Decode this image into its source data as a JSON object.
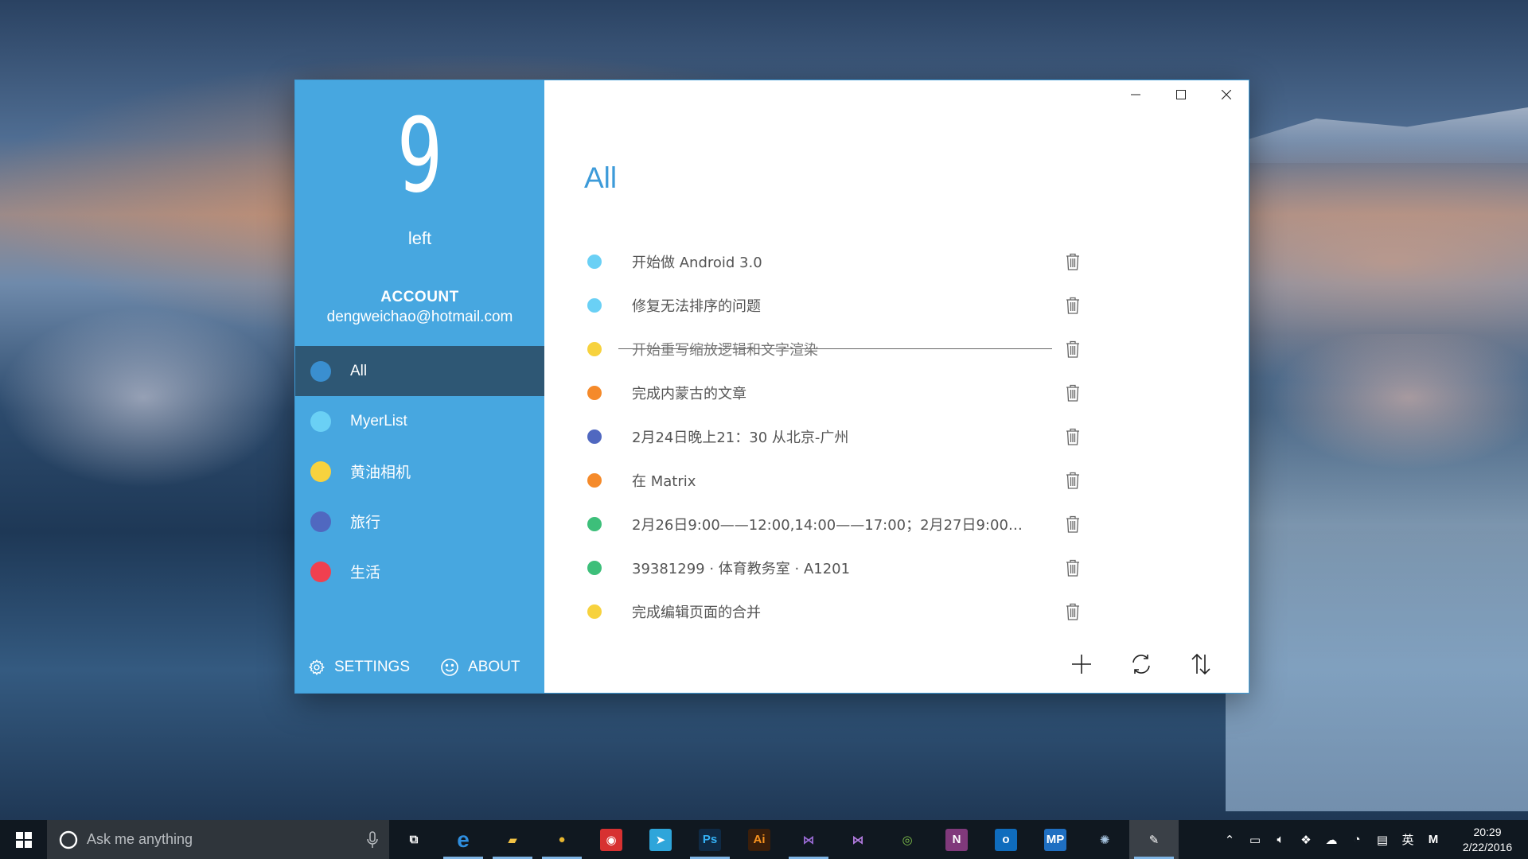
{
  "sidebar": {
    "count": "9",
    "count_caption": "left",
    "account_title": "ACCOUNT",
    "account_email": "dengweichao@hotmail.com",
    "categories": [
      {
        "label": "All",
        "color": "#3a8fd0",
        "active": true
      },
      {
        "label": "MyerList",
        "color": "#6ad0f5",
        "active": false
      },
      {
        "label": "黄油相机",
        "color": "#f7d23e",
        "active": false
      },
      {
        "label": "旅行",
        "color": "#5068c0",
        "active": false
      },
      {
        "label": "生活",
        "color": "#f0404f",
        "active": false
      }
    ],
    "settings_label": "SETTINGS",
    "about_label": "ABOUT"
  },
  "main": {
    "title": "All",
    "tasks": [
      {
        "text": "开始做 Android 3.0",
        "color": "#6ad0f5",
        "done": false
      },
      {
        "text": "修复无法排序的问题",
        "color": "#6ad0f5",
        "done": false
      },
      {
        "text": "开始重写缩放逻辑和文字渲染",
        "color": "#f7d23e",
        "done": true
      },
      {
        "text": "完成内蒙古的文章",
        "color": "#f58a2a",
        "done": false
      },
      {
        "text": "2月24日晚上21：30 从北京-广州",
        "color": "#5068c0",
        "done": false
      },
      {
        "text": "在 Matrix",
        "color": "#f58a2a",
        "done": false
      },
      {
        "text": "2月26日9:00——12:00,14:00——17:00；2月27日9:00——...",
        "color": "#3dbf7a",
        "done": false
      },
      {
        "text": "39381299 · 体育教务室 · A1201",
        "color": "#3dbf7a",
        "done": false
      },
      {
        "text": "完成编辑页面的合并",
        "color": "#f7d23e",
        "done": false
      }
    ]
  },
  "taskbar": {
    "search_placeholder": "Ask me anything",
    "apps": [
      {
        "name": "task-view",
        "glyph": "⧉",
        "bg": "transparent",
        "running": false
      },
      {
        "name": "edge",
        "glyph": "e",
        "bg": "transparent",
        "color": "#2f8fe0",
        "running": true
      },
      {
        "name": "file-explorer",
        "glyph": "▰",
        "bg": "transparent",
        "color": "#f2c244",
        "running": true
      },
      {
        "name": "chrome",
        "glyph": "●",
        "bg": "transparent",
        "color": "#e6b52f",
        "running": true
      },
      {
        "name": "netease-music",
        "glyph": "◉",
        "bg": "#d73131",
        "color": "#ffffff",
        "running": false
      },
      {
        "name": "telegram",
        "glyph": "➤",
        "bg": "#2ea5da",
        "color": "#ffffff",
        "running": false
      },
      {
        "name": "photoshop",
        "glyph": "Ps",
        "bg": "#0f2a45",
        "color": "#35b1f5",
        "running": true
      },
      {
        "name": "illustrator",
        "glyph": "Ai",
        "bg": "#3a1e0a",
        "color": "#f7921e",
        "running": false
      },
      {
        "name": "visual-studio",
        "glyph": "⋈",
        "bg": "transparent",
        "color": "#9b6bd6",
        "running": true
      },
      {
        "name": "blend",
        "glyph": "⋈",
        "bg": "transparent",
        "color": "#b47ce0",
        "running": false
      },
      {
        "name": "android-studio",
        "glyph": "◎",
        "bg": "transparent",
        "color": "#7fbf4a",
        "running": false
      },
      {
        "name": "onenote",
        "glyph": "N",
        "bg": "#80397b",
        "color": "#ffffff",
        "running": false
      },
      {
        "name": "outlook",
        "glyph": "o",
        "bg": "#0f6cbd",
        "color": "#ffffff",
        "running": false
      },
      {
        "name": "mp",
        "glyph": "MP",
        "bg": "#1f6fc2",
        "color": "#ffffff",
        "running": false
      },
      {
        "name": "globe-app",
        "glyph": "✺",
        "bg": "transparent",
        "color": "#a9c6e2",
        "running": false
      },
      {
        "name": "myerlist-app",
        "glyph": "✎",
        "bg": "transparent",
        "color": "#ffffff",
        "running": true
      }
    ],
    "tray": {
      "ime_label": "英",
      "m_label": "M",
      "time": "20:29",
      "date": "2/22/2016"
    }
  },
  "colors": {
    "accent": "#47a7e0",
    "active_nav": "#2e5774",
    "title": "#3d9bd9"
  }
}
